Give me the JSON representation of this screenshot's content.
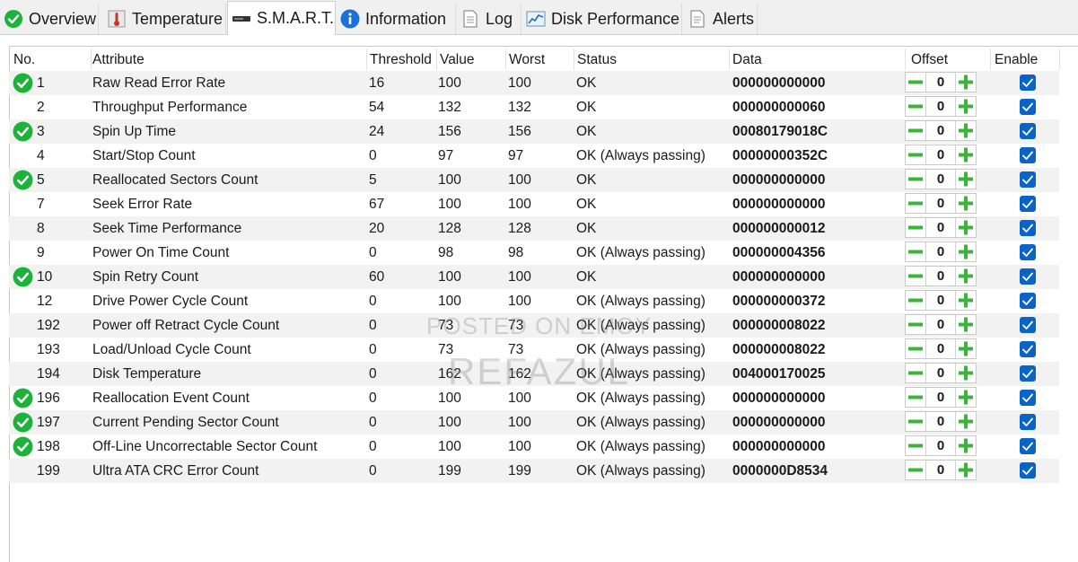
{
  "tabs": [
    {
      "label": "Overview",
      "icon": "green-check-icon",
      "active": false
    },
    {
      "label": "Temperature",
      "icon": "thermometer-icon",
      "active": false
    },
    {
      "label": "S.M.A.R.T.",
      "icon": "disk-drive-icon",
      "active": true
    },
    {
      "label": "Information",
      "icon": "info-icon",
      "active": false
    },
    {
      "label": "Log",
      "icon": "log-document-icon",
      "active": false
    },
    {
      "label": "Disk Performance",
      "icon": "performance-chart-icon",
      "active": false
    },
    {
      "label": "Alerts",
      "icon": "alerts-document-icon",
      "active": false
    }
  ],
  "table": {
    "columns": [
      "No.",
      "Attribute",
      "Threshold",
      "Value",
      "Worst",
      "Status",
      "Data",
      "Offset",
      "Enable"
    ],
    "rows": [
      {
        "no": "1",
        "attribute": "Raw Read Error Rate",
        "threshold": "16",
        "value": "100",
        "worst": "100",
        "status": "OK",
        "data": "000000000000",
        "offset": "0",
        "enabled": true,
        "check": true
      },
      {
        "no": "2",
        "attribute": "Throughput Performance",
        "threshold": "54",
        "value": "132",
        "worst": "132",
        "status": "OK",
        "data": "000000000060",
        "offset": "0",
        "enabled": true,
        "check": false
      },
      {
        "no": "3",
        "attribute": "Spin Up Time",
        "threshold": "24",
        "value": "156",
        "worst": "156",
        "status": "OK",
        "data": "00080179018C",
        "offset": "0",
        "enabled": true,
        "check": true
      },
      {
        "no": "4",
        "attribute": "Start/Stop Count",
        "threshold": "0",
        "value": "97",
        "worst": "97",
        "status": "OK (Always passing)",
        "data": "00000000352C",
        "offset": "0",
        "enabled": true,
        "check": false
      },
      {
        "no": "5",
        "attribute": "Reallocated Sectors Count",
        "threshold": "5",
        "value": "100",
        "worst": "100",
        "status": "OK",
        "data": "000000000000",
        "offset": "0",
        "enabled": true,
        "check": true
      },
      {
        "no": "7",
        "attribute": "Seek Error Rate",
        "threshold": "67",
        "value": "100",
        "worst": "100",
        "status": "OK",
        "data": "000000000000",
        "offset": "0",
        "enabled": true,
        "check": false
      },
      {
        "no": "8",
        "attribute": "Seek Time Performance",
        "threshold": "20",
        "value": "128",
        "worst": "128",
        "status": "OK",
        "data": "000000000012",
        "offset": "0",
        "enabled": true,
        "check": false
      },
      {
        "no": "9",
        "attribute": "Power On Time Count",
        "threshold": "0",
        "value": "98",
        "worst": "98",
        "status": "OK (Always passing)",
        "data": "000000004356",
        "offset": "0",
        "enabled": true,
        "check": false
      },
      {
        "no": "10",
        "attribute": "Spin Retry Count",
        "threshold": "60",
        "value": "100",
        "worst": "100",
        "status": "OK",
        "data": "000000000000",
        "offset": "0",
        "enabled": true,
        "check": true
      },
      {
        "no": "12",
        "attribute": "Drive Power Cycle Count",
        "threshold": "0",
        "value": "100",
        "worst": "100",
        "status": "OK (Always passing)",
        "data": "000000000372",
        "offset": "0",
        "enabled": true,
        "check": false
      },
      {
        "no": "192",
        "attribute": "Power off Retract Cycle Count",
        "threshold": "0",
        "value": "73",
        "worst": "73",
        "status": "OK (Always passing)",
        "data": "000000008022",
        "offset": "0",
        "enabled": true,
        "check": false
      },
      {
        "no": "193",
        "attribute": "Load/Unload Cycle Count",
        "threshold": "0",
        "value": "73",
        "worst": "73",
        "status": "OK (Always passing)",
        "data": "000000008022",
        "offset": "0",
        "enabled": true,
        "check": false
      },
      {
        "no": "194",
        "attribute": "Disk Temperature",
        "threshold": "0",
        "value": "162",
        "worst": "162",
        "status": "OK (Always passing)",
        "data": "004000170025",
        "offset": "0",
        "enabled": true,
        "check": false
      },
      {
        "no": "196",
        "attribute": "Reallocation Event Count",
        "threshold": "0",
        "value": "100",
        "worst": "100",
        "status": "OK (Always passing)",
        "data": "000000000000",
        "offset": "0",
        "enabled": true,
        "check": true
      },
      {
        "no": "197",
        "attribute": "Current Pending Sector Count",
        "threshold": "0",
        "value": "100",
        "worst": "100",
        "status": "OK (Always passing)",
        "data": "000000000000",
        "offset": "0",
        "enabled": true,
        "check": true
      },
      {
        "no": "198",
        "attribute": "Off-Line Uncorrectable Sector Count",
        "threshold": "0",
        "value": "100",
        "worst": "100",
        "status": "OK (Always passing)",
        "data": "000000000000",
        "offset": "0",
        "enabled": true,
        "check": true
      },
      {
        "no": "199",
        "attribute": "Ultra ATA CRC Error Count",
        "threshold": "0",
        "value": "199",
        "worst": "199",
        "status": "OK (Always passing)",
        "data": "0000000D8534",
        "offset": "0",
        "enabled": true,
        "check": false
      }
    ]
  },
  "watermark": {
    "line1": "POSTED ON EMOY",
    "line2": "REFAZUL"
  },
  "colors": {
    "check_green": "#1db33b",
    "offset_button_green": "#3cb43c",
    "checkbox_blue": "#0a64c8",
    "alt_row": "#f2f2f2"
  }
}
